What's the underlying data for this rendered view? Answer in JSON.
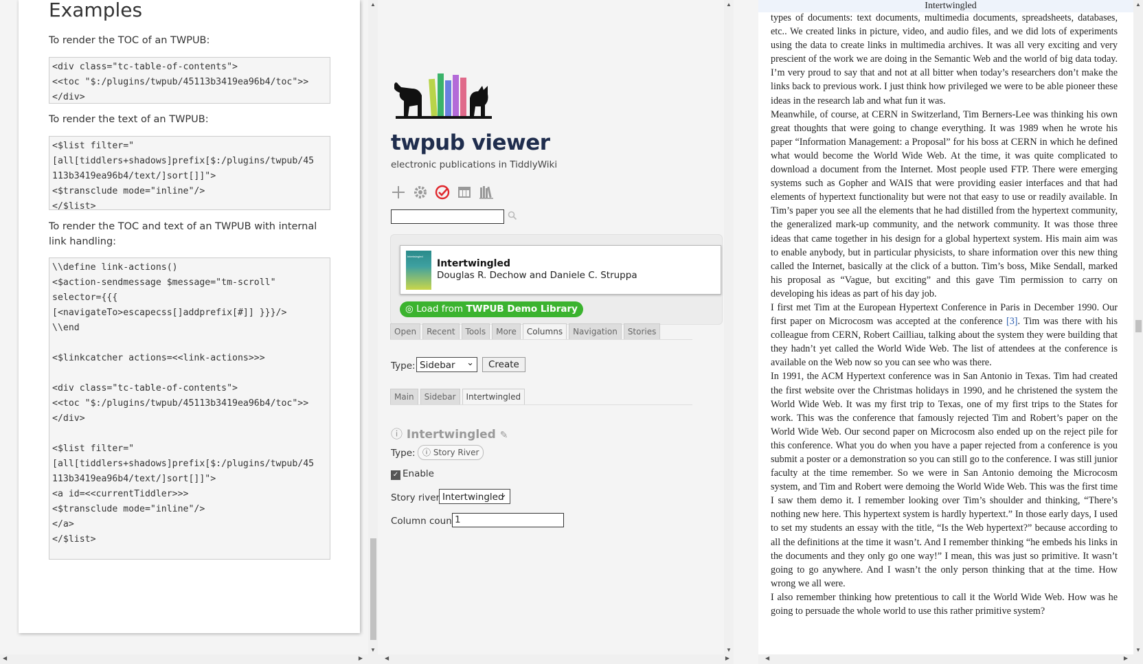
{
  "left": {
    "heading": "Examples",
    "p1": "To render the TOC of an TWPUB:",
    "code1": "<div class=\"tc-table-of-contents\">\n<<toc \"$:/plugins/twpub/45113b3419ea96b4/toc\">>\n</div>",
    "p2": "To render the text of an TWPUB:",
    "code2": "<$list filter=\"\n[all[tiddlers+shadows]prefix[$:/plugins/twpub/45\n113b3419ea96b4/text/]sort[]]\">\n<$transclude mode=\"inline\"/>\n</$list>",
    "p3": "To render the TOC and text of an TWPUB with internal link handling:",
    "code3": "\\\\define link-actions()\n<$action-sendmessage $message=\"tm-scroll\"\nselector={{{\n[<navigateTo>escapecss[]addprefix[#]] }}}/>\n\\\\end\n\n<$linkcatcher actions=<<link-actions>>>\n\n<div class=\"tc-table-of-contents\">\n<<toc \"$:/plugins/twpub/45113b3419ea96b4/toc\">>\n</div>\n\n<$list filter=\"\n[all[tiddlers+shadows]prefix[$:/plugins/twpub/45\n113b3419ea96b4/text/]sort[]]\">\n<a id=<<currentTiddler>>>\n<$transclude mode=\"inline\"/>\n</a>\n</$list>\n\n</$linkcatcher>"
  },
  "sidebar": {
    "title": "twpub viewer",
    "subtitle": "electronic publications in TiddlyWiki",
    "toolbar": [
      "new-tiddler-icon",
      "control-panel-icon",
      "check-icon",
      "layout-icon",
      "library-icon"
    ],
    "search_value": "",
    "book": {
      "title": "Intertwingled",
      "author": "Douglas R. Dechow and Daniele C. Struppa",
      "cover_label": "Intertwingled"
    },
    "load_button": {
      "prefix": "Load from",
      "bold": "TWPUB Demo Library"
    },
    "tabs": [
      "Open",
      "Recent",
      "Tools",
      "More",
      "Columns",
      "Navigation",
      "Stories"
    ],
    "active_tab": "Columns",
    "type_label": "Type:",
    "type_value": "Sidebar",
    "create_label": "Create",
    "subtabs": [
      "Main",
      "Sidebar",
      "Intertwingled"
    ],
    "active_subtab": "Intertwingled",
    "tiddler_title": "Intertwingled",
    "type2_label": "Type:",
    "type2_value": "Story River",
    "enable_label": "Enable",
    "enable_checked": true,
    "story_river_label": "Story river:",
    "story_river_value": "Intertwingled",
    "column_count_label": "Column count:",
    "column_count_value": "1"
  },
  "reader": {
    "title": "Intertwingled",
    "p1": "types of documents: text documents, multimedia documents, spreadsheets, databases, etc.. We created links in picture, video, and audio files, and we did lots of experiments using the data to create links in multimedia archives. It was all very exciting and very prescient of the work we are doing in the Semantic Web and the world of big data today. I’m very proud to say that and not at all bitter when today’s researchers don’t make the links back to previous work. I just think how privileged we were to be able pioneer these ideas in the research lab and what fun it was.",
    "p2": "Meanwhile, of course, at CERN in Switzerland, Tim Berners-Lee was thinking his own great thoughts that were going to change everything. It was 1989 when he wrote his paper “Information Management: a Proposal” for his boss at CERN in which he defined what would become the World Wide Web. At the time, it was quite complicated to download a document from the Internet. Most people used FTP. There were emerging systems such as Gopher and WAIS that were providing easier interfaces and that had elements of hypertext functionality but were not that easy to use or readily available. In Tim’s paper you see all the elements that he had distilled from the hypertext community, the generalized mark-up community, and the network community. It was those three ideas that came together in his design for a global hypertext system. His main aim was to enable anybody, but in particular physicists, to share information over this new thing called the Internet, basically at the click of a button. Tim’s boss, Mike Sendall, marked his proposal as “Vague, but exciting” and this gave Tim permission to carry on developing his ideas as part of his day job.",
    "p3a": "I first met Tim at the European Hypertext Conference in Paris in December 1990. Our first paper on Microcosm was accepted at the conference ",
    "p3ref": "[3]",
    "p3b": ". Tim was there with his colleague from CERN, Robert Cailliau, talking about the system they were building that they hadn’t yet called the World Wide Web. The list of attendees at the conference is available on the Web now so you can see who was there.",
    "p4": "In 1991, the ACM Hypertext conference was in San Antonio in Texas. Tim had created the first website over the Christmas holidays in 1990, and he christened the system the World Wide Web. It was my first trip to Texas, one of my first trips to the States for work. This was the conference that famously rejected Tim and Robert’s paper on the World Wide Web. Our second paper on Microcosm also ended up on the reject pile for this conference. What you do when you have a paper rejected from a conference is you submit a poster or a demonstration so you can still go to the conference. I was still junior faculty at the time remember. So we were in San Antonio demoing the Microcosm system, and Tim and Robert were demoing the World Wide Web. This was the first time I saw them demo it. I remember looking over Tim’s shoulder and thinking, “There’s nothing new here. This hypertext system is hardly hypertext.” In those early days, I used to set my students an essay with the title, “Is the Web hypertext?” because according to all the definitions at the time it wasn’t. And I remember thinking “he embeds his links in the documents and they only go one way!” I mean, this was just so primitive. It wasn’t going to go anywhere. And I wasn’t the only person thinking that at the time. How wrong we all were.",
    "p5": "I also remember thinking how pretentious to call it the World Wide Web. How was he going to persuade the whole world to use this rather primitive system?"
  }
}
